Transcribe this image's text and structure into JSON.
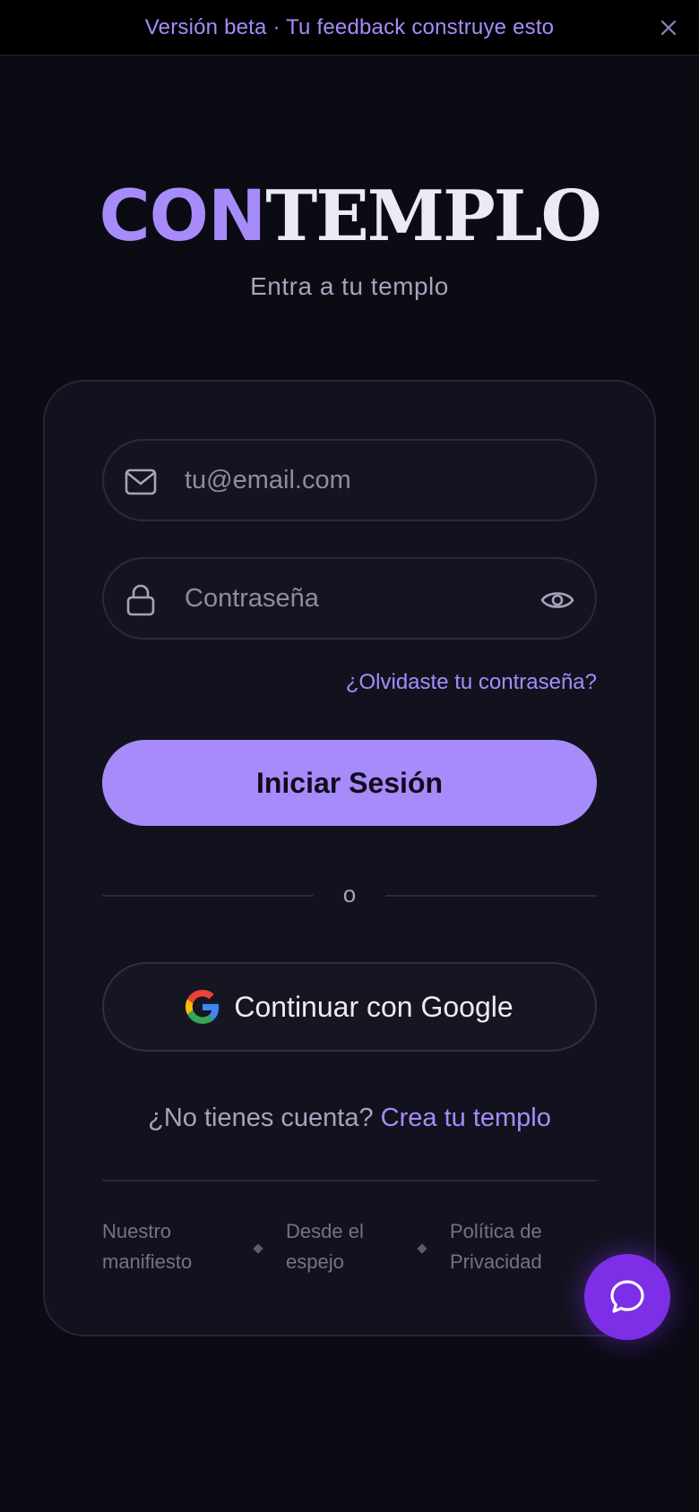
{
  "banner": {
    "text": "Versión beta · Tu feedback construye esto",
    "close_icon": "close-icon"
  },
  "logo": {
    "part1": "CON",
    "part2": "TEMPLO"
  },
  "tagline": "Entra a tu templo",
  "form": {
    "email_placeholder": "tu@email.com",
    "email_icon": "mail-icon",
    "password_placeholder": "Contraseña",
    "password_icon": "lock-icon",
    "toggle_visibility_icon": "eye-icon",
    "forgot_password": "¿Olvidaste tu contraseña?",
    "login_button": "Iniciar Sesión",
    "divider": "o",
    "google_button": "Continuar con Google"
  },
  "signup": {
    "prompt": "¿No tienes cuenta?",
    "link": "Crea tu templo"
  },
  "footer": {
    "links": [
      {
        "line1": "Nuestro",
        "line2": "manifiesto"
      },
      {
        "line1": "Desde el",
        "line2": "espejo"
      },
      {
        "line1": "Política de",
        "line2": "Privacidad"
      }
    ]
  },
  "colors": {
    "accent": "#a78bfa",
    "background": "#0b0b14",
    "card": "#12121e",
    "fab": "#7c2fe6"
  },
  "chat_fab_icon": "chat-bubble-icon"
}
